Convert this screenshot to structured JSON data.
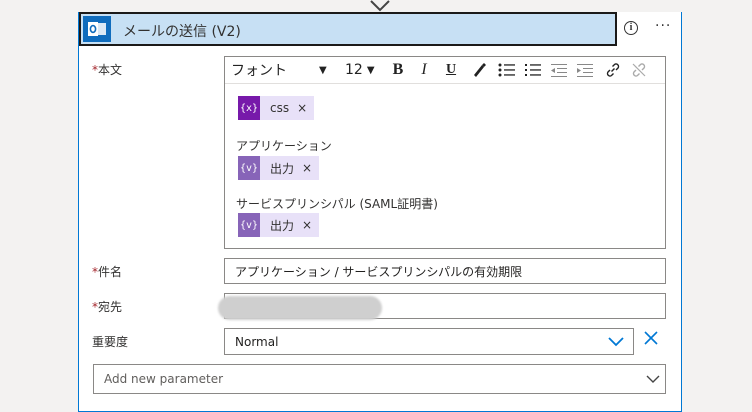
{
  "action": {
    "title": "メールの送信 (V2)",
    "info_icon": "info-icon",
    "more_label": "···"
  },
  "toolbar": {
    "font_label": "フォント",
    "size_label": "12",
    "bold": "B",
    "italic": "I",
    "underline": "U"
  },
  "body_field": {
    "label": "本文",
    "required_mark": "*",
    "sections": [
      {
        "label": "",
        "token": {
          "icon": "{x}",
          "text": "css",
          "color": "#7719aa"
        }
      },
      {
        "label": "アプリケーション",
        "token": {
          "icon": "{v}",
          "text": "出力",
          "color": "#8764b8"
        }
      },
      {
        "label": "サービスプリンシパル (SAML証明書)",
        "token": {
          "icon": "{v}",
          "text": "出力",
          "color": "#8764b8"
        }
      }
    ],
    "remove_label": "×"
  },
  "subject_field": {
    "label": "件名",
    "required_mark": "*",
    "value": "アプリケーション / サービスプリンシパルの有効期限"
  },
  "to_field": {
    "label": "宛先",
    "required_mark": "*"
  },
  "importance_field": {
    "label": "重要度",
    "value": "Normal"
  },
  "add_param": {
    "placeholder": "Add new parameter"
  },
  "colors": {
    "accent": "#0078d4",
    "header_bg": "#c7e0f4",
    "required": "#a4262c"
  }
}
